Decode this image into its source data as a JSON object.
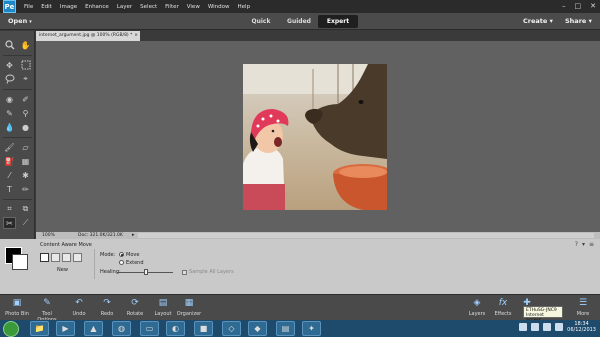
{
  "menubar": {
    "app_icon_label": "Pe",
    "items": [
      "File",
      "Edit",
      "Image",
      "Enhance",
      "Layer",
      "Select",
      "Filter",
      "View",
      "Window",
      "Help"
    ],
    "win_controls": [
      "–",
      "□",
      "✕"
    ]
  },
  "modebar": {
    "open_label": "Open",
    "tabs": [
      "Quick",
      "Guided",
      "Expert"
    ],
    "active_tab": "Expert",
    "create_label": "Create",
    "share_label": "Share"
  },
  "document": {
    "tab_title": "internet_argument.jpg @ 100% (RGB/8) *",
    "zoom": "100%",
    "doc_size": "Doc: 321.0K/321.0K"
  },
  "tool_options": {
    "title": "Content Aware Move",
    "new_label": "New",
    "mode_label": "Mode:",
    "mode_options": [
      "Move",
      "Extend"
    ],
    "selected_mode": "Move",
    "healing_label": "Healing:",
    "sample_all_layers_label": "Sample All Layers"
  },
  "bottombar": {
    "left_items": [
      {
        "label": "Photo Bin",
        "icon": "photo-bin-icon"
      },
      {
        "label": "Tool Options",
        "icon": "tool-options-icon"
      },
      {
        "label": "Undo",
        "icon": "undo-icon"
      },
      {
        "label": "Redo",
        "icon": "redo-icon"
      },
      {
        "label": "Rotate",
        "icon": "rotate-icon"
      },
      {
        "label": "Layout",
        "icon": "layout-icon"
      },
      {
        "label": "Organizer",
        "icon": "organizer-icon"
      }
    ],
    "right_items": [
      {
        "label": "Layers",
        "icon": "layers-icon"
      },
      {
        "label": "Effects",
        "icon": "effects-icon"
      },
      {
        "label": "Gr",
        "icon": "graphics-icon"
      },
      {
        "label": "More",
        "icon": "more-icon"
      }
    ]
  },
  "tooltip": {
    "line1": "ETHuSG-JNC9",
    "line2": "Internet access"
  },
  "taskbar": {
    "clock_time": "18:34",
    "clock_date": "06/12/2013"
  },
  "colors": {
    "accent": "#1e88c7",
    "canvas": "#616161",
    "panel": "#4a4a4a",
    "options_panel": "#c9c9c9",
    "taskbar": "#1e4a6b"
  }
}
